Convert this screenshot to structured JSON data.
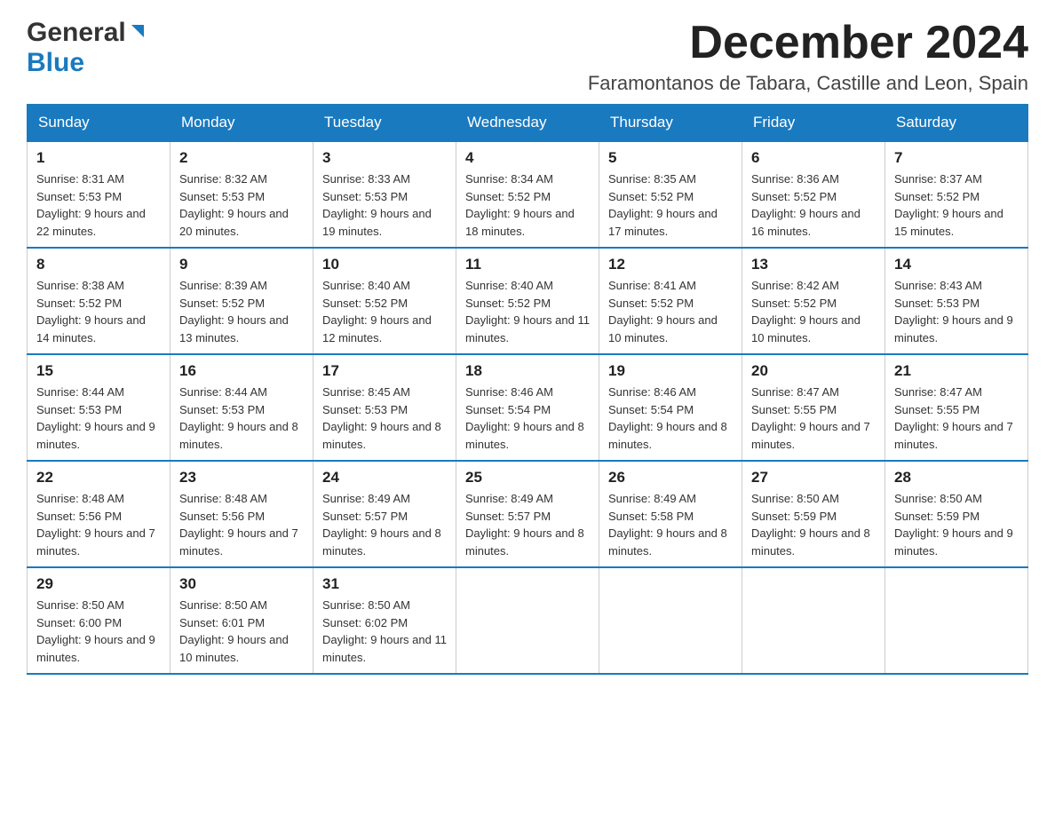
{
  "logo": {
    "general": "General",
    "blue": "Blue"
  },
  "header": {
    "month_year": "December 2024",
    "location": "Faramontanos de Tabara, Castille and Leon, Spain"
  },
  "weekdays": [
    "Sunday",
    "Monday",
    "Tuesday",
    "Wednesday",
    "Thursday",
    "Friday",
    "Saturday"
  ],
  "weeks": [
    [
      {
        "day": "1",
        "sunrise": "8:31 AM",
        "sunset": "5:53 PM",
        "daylight": "9 hours and 22 minutes."
      },
      {
        "day": "2",
        "sunrise": "8:32 AM",
        "sunset": "5:53 PM",
        "daylight": "9 hours and 20 minutes."
      },
      {
        "day": "3",
        "sunrise": "8:33 AM",
        "sunset": "5:53 PM",
        "daylight": "9 hours and 19 minutes."
      },
      {
        "day": "4",
        "sunrise": "8:34 AM",
        "sunset": "5:52 PM",
        "daylight": "9 hours and 18 minutes."
      },
      {
        "day": "5",
        "sunrise": "8:35 AM",
        "sunset": "5:52 PM",
        "daylight": "9 hours and 17 minutes."
      },
      {
        "day": "6",
        "sunrise": "8:36 AM",
        "sunset": "5:52 PM",
        "daylight": "9 hours and 16 minutes."
      },
      {
        "day": "7",
        "sunrise": "8:37 AM",
        "sunset": "5:52 PM",
        "daylight": "9 hours and 15 minutes."
      }
    ],
    [
      {
        "day": "8",
        "sunrise": "8:38 AM",
        "sunset": "5:52 PM",
        "daylight": "9 hours and 14 minutes."
      },
      {
        "day": "9",
        "sunrise": "8:39 AM",
        "sunset": "5:52 PM",
        "daylight": "9 hours and 13 minutes."
      },
      {
        "day": "10",
        "sunrise": "8:40 AM",
        "sunset": "5:52 PM",
        "daylight": "9 hours and 12 minutes."
      },
      {
        "day": "11",
        "sunrise": "8:40 AM",
        "sunset": "5:52 PM",
        "daylight": "9 hours and 11 minutes."
      },
      {
        "day": "12",
        "sunrise": "8:41 AM",
        "sunset": "5:52 PM",
        "daylight": "9 hours and 10 minutes."
      },
      {
        "day": "13",
        "sunrise": "8:42 AM",
        "sunset": "5:52 PM",
        "daylight": "9 hours and 10 minutes."
      },
      {
        "day": "14",
        "sunrise": "8:43 AM",
        "sunset": "5:53 PM",
        "daylight": "9 hours and 9 minutes."
      }
    ],
    [
      {
        "day": "15",
        "sunrise": "8:44 AM",
        "sunset": "5:53 PM",
        "daylight": "9 hours and 9 minutes."
      },
      {
        "day": "16",
        "sunrise": "8:44 AM",
        "sunset": "5:53 PM",
        "daylight": "9 hours and 8 minutes."
      },
      {
        "day": "17",
        "sunrise": "8:45 AM",
        "sunset": "5:53 PM",
        "daylight": "9 hours and 8 minutes."
      },
      {
        "day": "18",
        "sunrise": "8:46 AM",
        "sunset": "5:54 PM",
        "daylight": "9 hours and 8 minutes."
      },
      {
        "day": "19",
        "sunrise": "8:46 AM",
        "sunset": "5:54 PM",
        "daylight": "9 hours and 8 minutes."
      },
      {
        "day": "20",
        "sunrise": "8:47 AM",
        "sunset": "5:55 PM",
        "daylight": "9 hours and 7 minutes."
      },
      {
        "day": "21",
        "sunrise": "8:47 AM",
        "sunset": "5:55 PM",
        "daylight": "9 hours and 7 minutes."
      }
    ],
    [
      {
        "day": "22",
        "sunrise": "8:48 AM",
        "sunset": "5:56 PM",
        "daylight": "9 hours and 7 minutes."
      },
      {
        "day": "23",
        "sunrise": "8:48 AM",
        "sunset": "5:56 PM",
        "daylight": "9 hours and 7 minutes."
      },
      {
        "day": "24",
        "sunrise": "8:49 AM",
        "sunset": "5:57 PM",
        "daylight": "9 hours and 8 minutes."
      },
      {
        "day": "25",
        "sunrise": "8:49 AM",
        "sunset": "5:57 PM",
        "daylight": "9 hours and 8 minutes."
      },
      {
        "day": "26",
        "sunrise": "8:49 AM",
        "sunset": "5:58 PM",
        "daylight": "9 hours and 8 minutes."
      },
      {
        "day": "27",
        "sunrise": "8:50 AM",
        "sunset": "5:59 PM",
        "daylight": "9 hours and 8 minutes."
      },
      {
        "day": "28",
        "sunrise": "8:50 AM",
        "sunset": "5:59 PM",
        "daylight": "9 hours and 9 minutes."
      }
    ],
    [
      {
        "day": "29",
        "sunrise": "8:50 AM",
        "sunset": "6:00 PM",
        "daylight": "9 hours and 9 minutes."
      },
      {
        "day": "30",
        "sunrise": "8:50 AM",
        "sunset": "6:01 PM",
        "daylight": "9 hours and 10 minutes."
      },
      {
        "day": "31",
        "sunrise": "8:50 AM",
        "sunset": "6:02 PM",
        "daylight": "9 hours and 11 minutes."
      },
      null,
      null,
      null,
      null
    ]
  ]
}
